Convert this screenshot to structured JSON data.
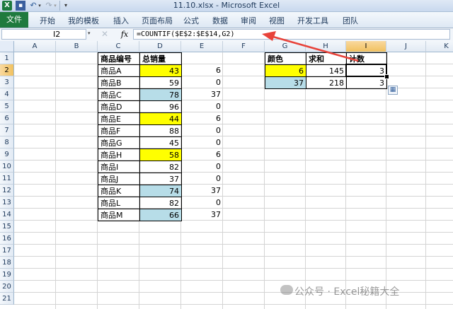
{
  "window": {
    "title": "11.10.xlsx - Microsoft Excel"
  },
  "qat": {
    "app_icon": "X",
    "save_icon": "💾",
    "undo_icon": "↶",
    "redo_icon": "↷",
    "dropdown": "▾",
    "more": "▾"
  },
  "ribbon": {
    "file_tab": "文件",
    "tabs": [
      "开始",
      "我的模板",
      "插入",
      "页面布局",
      "公式",
      "数据",
      "审阅",
      "视图",
      "开发工具",
      "团队"
    ]
  },
  "formula_bar": {
    "name_box": "I2",
    "cancel_icon": "✕",
    "fx": "fx",
    "formula": "=COUNTIF($E$2:$E$14,G2)"
  },
  "columns": [
    "A",
    "B",
    "C",
    "D",
    "E",
    "F",
    "G",
    "H",
    "I",
    "J",
    "K"
  ],
  "selected_column": "I",
  "rows": [
    "1",
    "2",
    "3",
    "4",
    "5",
    "6",
    "7",
    "8",
    "9",
    "10",
    "11",
    "12",
    "13",
    "14",
    "15",
    "16",
    "17",
    "18",
    "19",
    "20",
    "21"
  ],
  "selected_row": "2",
  "table1": {
    "headers": [
      "商品编号",
      "总销量"
    ],
    "rows": [
      {
        "item": "商品A",
        "sales": "43",
        "e": "6",
        "color": "yellow"
      },
      {
        "item": "商品B",
        "sales": "59",
        "e": "0",
        "color": "none"
      },
      {
        "item": "商品C",
        "sales": "78",
        "e": "37",
        "color": "blue"
      },
      {
        "item": "商品D",
        "sales": "96",
        "e": "0",
        "color": "none"
      },
      {
        "item": "商品E",
        "sales": "44",
        "e": "6",
        "color": "yellow"
      },
      {
        "item": "商品F",
        "sales": "88",
        "e": "0",
        "color": "none"
      },
      {
        "item": "商品G",
        "sales": "45",
        "e": "0",
        "color": "none"
      },
      {
        "item": "商品H",
        "sales": "58",
        "e": "6",
        "color": "yellow"
      },
      {
        "item": "商品I",
        "sales": "82",
        "e": "0",
        "color": "none"
      },
      {
        "item": "商品J",
        "sales": "37",
        "e": "0",
        "color": "none"
      },
      {
        "item": "商品K",
        "sales": "74",
        "e": "37",
        "color": "blue"
      },
      {
        "item": "商品L",
        "sales": "82",
        "e": "0",
        "color": "none"
      },
      {
        "item": "商品M",
        "sales": "66",
        "e": "37",
        "color": "blue"
      }
    ]
  },
  "table2": {
    "headers": [
      "颜色",
      "求和",
      "计数"
    ],
    "rows": [
      {
        "color_code": "6",
        "sum": "145",
        "count": "3",
        "color": "yellow"
      },
      {
        "color_code": "37",
        "sum": "218",
        "count": "3",
        "color": "blue"
      }
    ]
  },
  "colors": {
    "yellow": "#ffff00",
    "blue": "#b7dde8",
    "annotation_arrow": "#e8433a",
    "selection": "#f1c15f"
  },
  "paste_options_icon": "📋",
  "watermark": "公众号 · Excel秘籍大全"
}
